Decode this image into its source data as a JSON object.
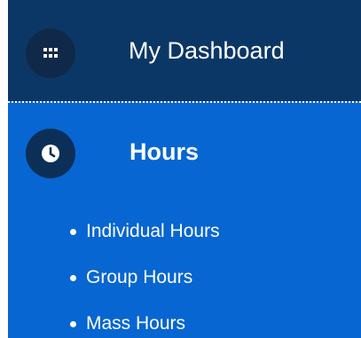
{
  "dashboard": {
    "label": "My Dashboard",
    "icon": "grid-icon"
  },
  "hours": {
    "label": "Hours",
    "icon": "clock-icon",
    "items": [
      {
        "label": "Individual Hours"
      },
      {
        "label": "Group Hours"
      },
      {
        "label": "Mass Hours"
      }
    ]
  },
  "colors": {
    "dashboard_bg": "#0b3766",
    "menu_bg": "#0766d1",
    "icon_circle": "#10294a",
    "text": "#ffffff"
  }
}
